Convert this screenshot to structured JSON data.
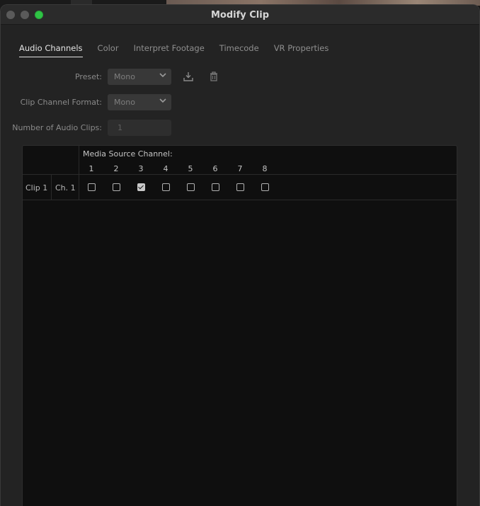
{
  "window": {
    "title": "Modify Clip"
  },
  "tabs": [
    {
      "label": "Audio Channels",
      "active": true
    },
    {
      "label": "Color",
      "active": false
    },
    {
      "label": "Interpret Footage",
      "active": false
    },
    {
      "label": "Timecode",
      "active": false
    },
    {
      "label": "VR Properties",
      "active": false
    }
  ],
  "form": {
    "preset": {
      "label": "Preset:",
      "value": "Mono"
    },
    "clip_channel_format": {
      "label": "Clip Channel Format:",
      "value": "Mono"
    },
    "number_of_audio_clips": {
      "label": "Number of Audio Clips:",
      "value": "1"
    }
  },
  "icons": {
    "save_preset": "save-preset-icon",
    "delete_preset": "trash-icon"
  },
  "grid": {
    "header": "Media Source Channel:",
    "channels": [
      "1",
      "2",
      "3",
      "4",
      "5",
      "6",
      "7",
      "8"
    ],
    "rows": [
      {
        "clip": "Clip 1",
        "channel": "Ch. 1",
        "checked": [
          false,
          false,
          true,
          false,
          false,
          false,
          false,
          false
        ]
      }
    ]
  },
  "colors": {
    "window_bg": "#232323",
    "grid_bg": "#0f0f0f",
    "maximize_green": "#2fc445"
  }
}
